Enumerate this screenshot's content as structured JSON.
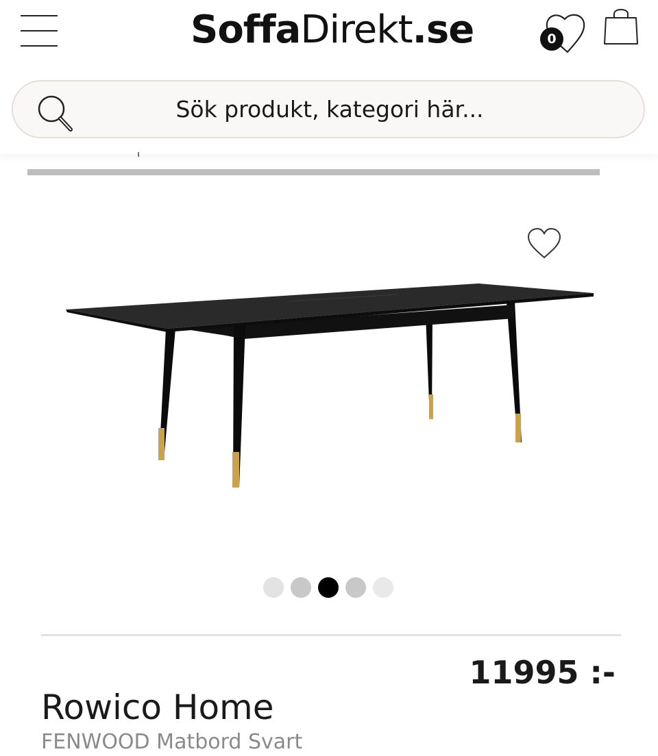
{
  "header": {
    "logo": {
      "part_bold": "Soffa",
      "part_regular": "Direkt",
      "part_suffix": ".se"
    },
    "wishlist_count": "0"
  },
  "search": {
    "placeholder": "Sök produkt, kategori här..."
  },
  "gallery": {
    "active_index": 2,
    "dot_colors": [
      "#e3e3e3",
      "#c8c8c8",
      "#000000",
      "#c8c8c8",
      "#e9e9e9"
    ]
  },
  "product": {
    "price": "11995 :-",
    "brand": "Rowico Home",
    "name": "FENWOOD Matbord Svart"
  },
  "icons": [
    "menu-icon",
    "heart-icon",
    "shopping-bag-icon",
    "search-icon",
    "favorite-heart-icon"
  ]
}
